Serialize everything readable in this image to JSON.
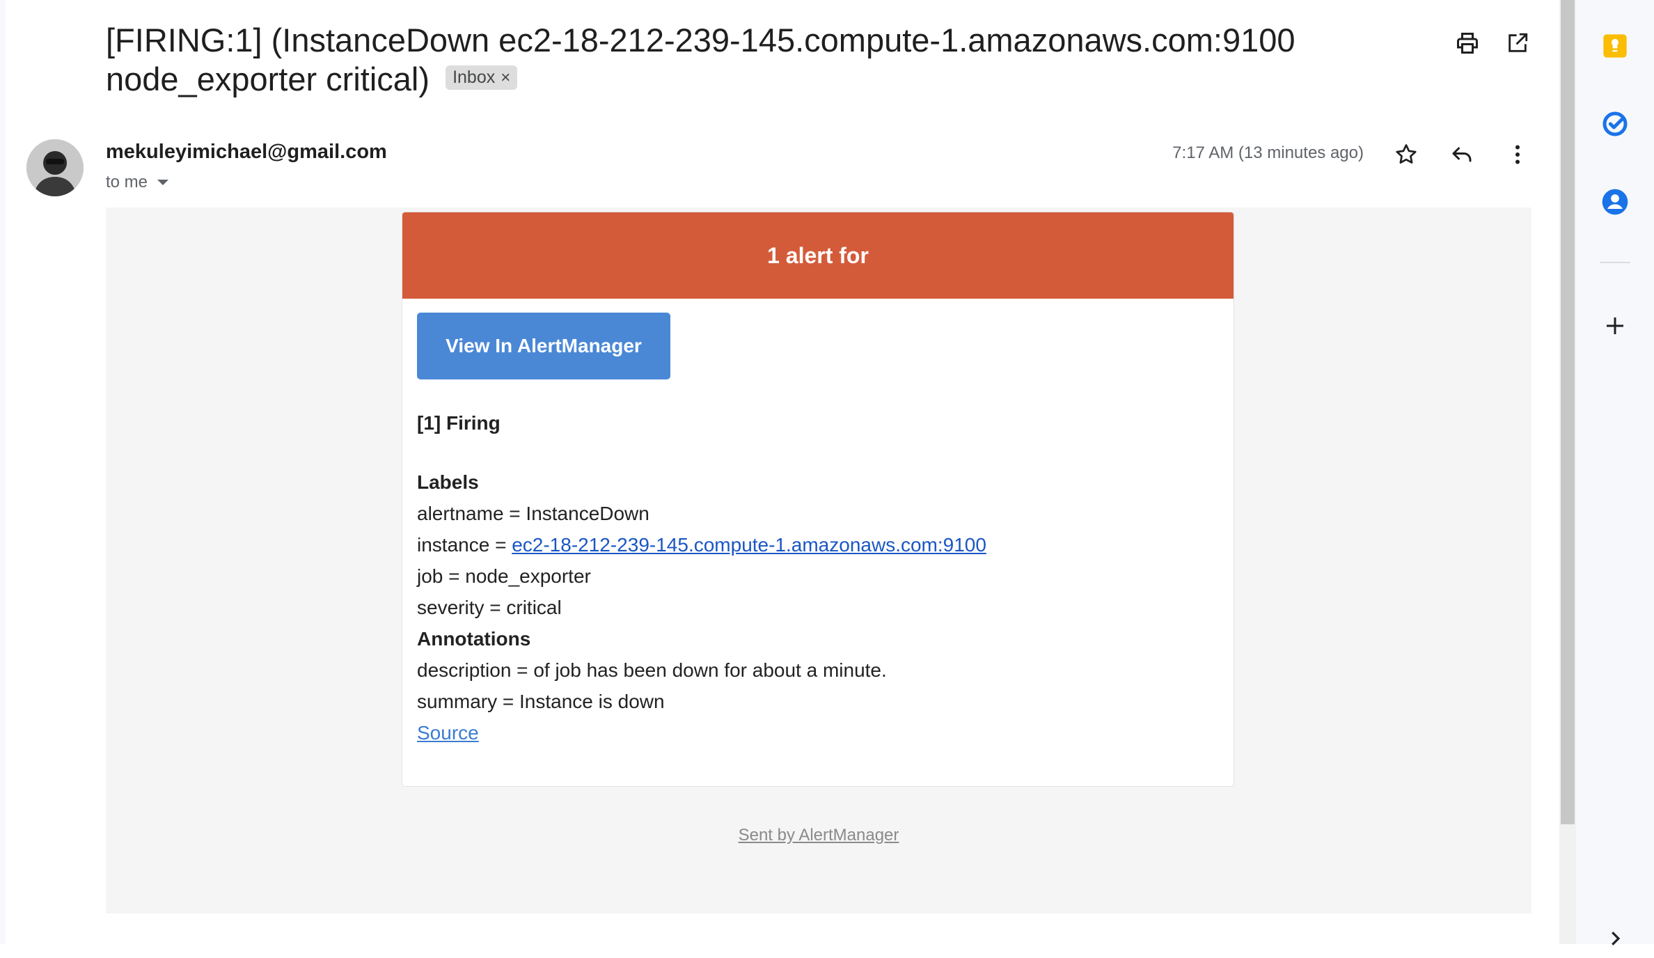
{
  "subject": {
    "text": "[FIRING:1] (InstanceDown ec2-18-212-239-145.compute-1.amazonaws.com:9100 node_exporter critical)",
    "label_chip": "Inbox",
    "chip_close": "×"
  },
  "header_actions": {
    "print_icon": "print-icon",
    "open_new_window_icon": "open-in-new-icon"
  },
  "message": {
    "sender": "mekuleyimichael@gmail.com",
    "recipient": "to me",
    "timestamp": "7:17 AM (13 minutes ago)",
    "actions": [
      "star-icon",
      "reply-icon",
      "more-vert-icon"
    ]
  },
  "email": {
    "banner": "1 alert for",
    "button": "View In AlertManager",
    "firing": "[1] Firing",
    "labels_heading": "Labels",
    "labels": {
      "alertname": "alertname = InstanceDown",
      "instance_prefix": "instance = ",
      "instance_link": "ec2-18-212-239-145.compute-1.amazonaws.com:9100",
      "job": "job = node_exporter",
      "severity": "severity = critical"
    },
    "annotations_heading": "Annotations",
    "annotations": {
      "description": "description = of job has been down for about a minute.",
      "summary": "summary = Instance is down"
    },
    "source": "Source",
    "footer": "Sent by AlertManager"
  },
  "colors": {
    "banner": "#d45b3a",
    "button": "#4a88d6",
    "link": "#1a56c4",
    "keep": "#fbbc04",
    "tasks": "#1a73e8",
    "contacts": "#1a73e8"
  },
  "side_panel": [
    "keep-icon",
    "tasks-icon",
    "contacts-icon",
    "add-icon"
  ]
}
